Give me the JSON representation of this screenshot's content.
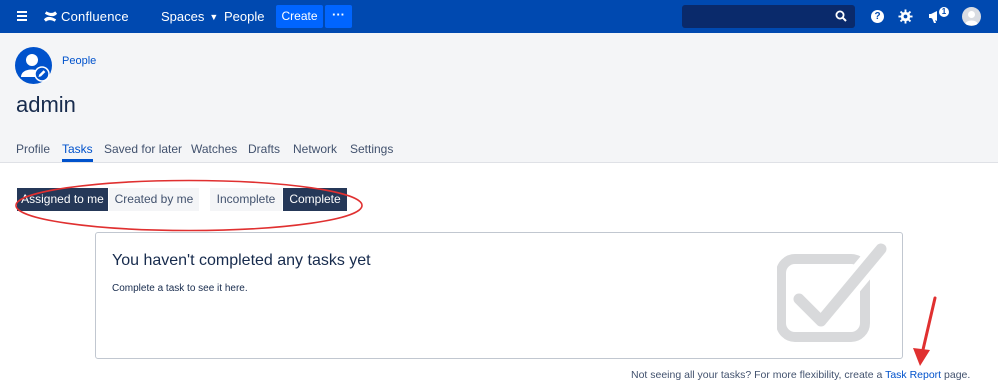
{
  "topnav": {
    "brand": "Confluence",
    "spaces_label": "Spaces",
    "people_label": "People",
    "create_label": "Create",
    "more_label": "···",
    "notification_count": "1",
    "help_glyph": "?",
    "icons": [
      "menu-icon",
      "confluence-logo-icon",
      "chevron-down-icon",
      "search-icon",
      "help-icon",
      "gear-icon",
      "notifications-icon",
      "avatar"
    ]
  },
  "header": {
    "breadcrumb": "People",
    "title": "admin"
  },
  "tabs": [
    {
      "label": "Profile",
      "active": false
    },
    {
      "label": "Tasks",
      "active": true
    },
    {
      "label": "Saved for later",
      "active": false
    },
    {
      "label": "Watches",
      "active": false
    },
    {
      "label": "Drafts",
      "active": false
    },
    {
      "label": "Network",
      "active": false
    },
    {
      "label": "Settings",
      "active": false
    }
  ],
  "filters": {
    "assigned": {
      "label": "Assigned to me",
      "selected": true
    },
    "created": {
      "label": "Created by me",
      "selected": false
    },
    "incomplete": {
      "label": "Incomplete",
      "selected": false
    },
    "complete": {
      "label": "Complete",
      "selected": true
    }
  },
  "empty_state": {
    "heading": "You haven't completed any tasks yet",
    "body": "Complete a task to see it here."
  },
  "footer": {
    "prefix": "Not seeing all your tasks? For more flexibility, create a ",
    "link": "Task Report",
    "suffix": " page."
  },
  "colors": {
    "nav_bg": "#0049b0",
    "accent": "#0052cc",
    "selected_filter": "#253858",
    "annotation_red": "#e03030"
  }
}
